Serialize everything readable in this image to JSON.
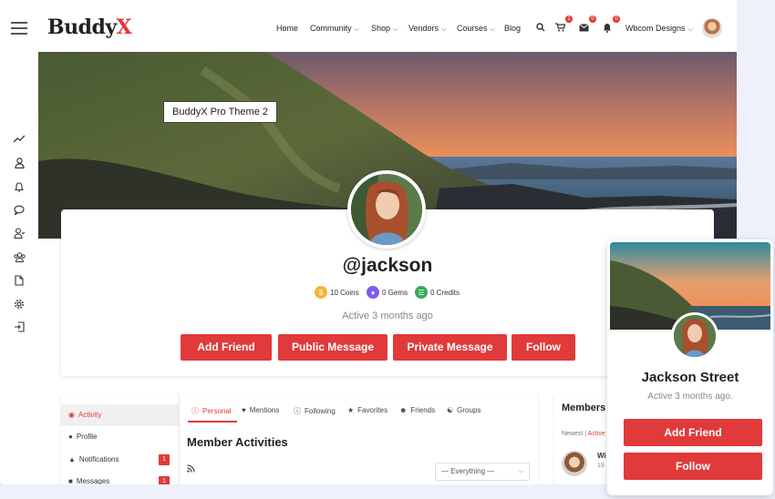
{
  "brand": {
    "logo_main": "Buddy",
    "logo_accent": "X"
  },
  "nav": {
    "items": [
      {
        "label": "Home",
        "has_dropdown": false
      },
      {
        "label": "Community",
        "has_dropdown": true
      },
      {
        "label": "Shop",
        "has_dropdown": true
      },
      {
        "label": "Vendors",
        "has_dropdown": true
      },
      {
        "label": "Courses",
        "has_dropdown": true
      },
      {
        "label": "Blog",
        "has_dropdown": false
      }
    ],
    "cart_badge": "1",
    "messages_badge": "0",
    "notifications_badge": "0",
    "user_name": "Wbcom Designs"
  },
  "sidebar": {
    "icons": [
      "activity-icon",
      "user-icon",
      "bell-icon",
      "chat-icon",
      "friends-icon",
      "groups-icon",
      "document-icon",
      "settings-icon",
      "logout-icon"
    ]
  },
  "cover": {
    "tooltip": "BuddyX Pro Theme 2"
  },
  "profile": {
    "handle": "@jackson",
    "points": [
      {
        "label": "10 Coins",
        "color": "#f2b531",
        "icon": "coin-icon"
      },
      {
        "label": "0 Gems",
        "color": "#7b5cf0",
        "icon": "gem-icon"
      },
      {
        "label": "0 Credits",
        "color": "#3aa85a",
        "icon": "credits-icon"
      }
    ],
    "active": "Active 3 months ago",
    "buttons": {
      "add_friend": "Add Friend",
      "public_message": "Public Message",
      "private_message": "Private Message",
      "follow": "Follow"
    }
  },
  "left_menu": {
    "items": [
      {
        "label": "Activity",
        "active": true,
        "badge": ""
      },
      {
        "label": "Profile",
        "active": false,
        "badge": ""
      },
      {
        "label": "Notifications",
        "active": false,
        "badge": "1"
      },
      {
        "label": "Messages",
        "active": false,
        "badge": "1"
      }
    ]
  },
  "activity": {
    "tabs": [
      "Personal",
      "Mentions",
      "Following",
      "Favorites",
      "Friends",
      "Groups"
    ],
    "title": "Member Activities",
    "filter": "— Everything —"
  },
  "members_widget": {
    "title": "Members",
    "tabs": [
      "Newest",
      "Active"
    ],
    "first_name": "Wi",
    "first_sub": "19"
  },
  "hover_card": {
    "name": "Jackson Street",
    "active": "Active 3 months ago.",
    "add_friend": "Add Friend",
    "follow": "Follow"
  },
  "colors": {
    "accent": "#e03a3a",
    "bg": "#eef0fb"
  }
}
